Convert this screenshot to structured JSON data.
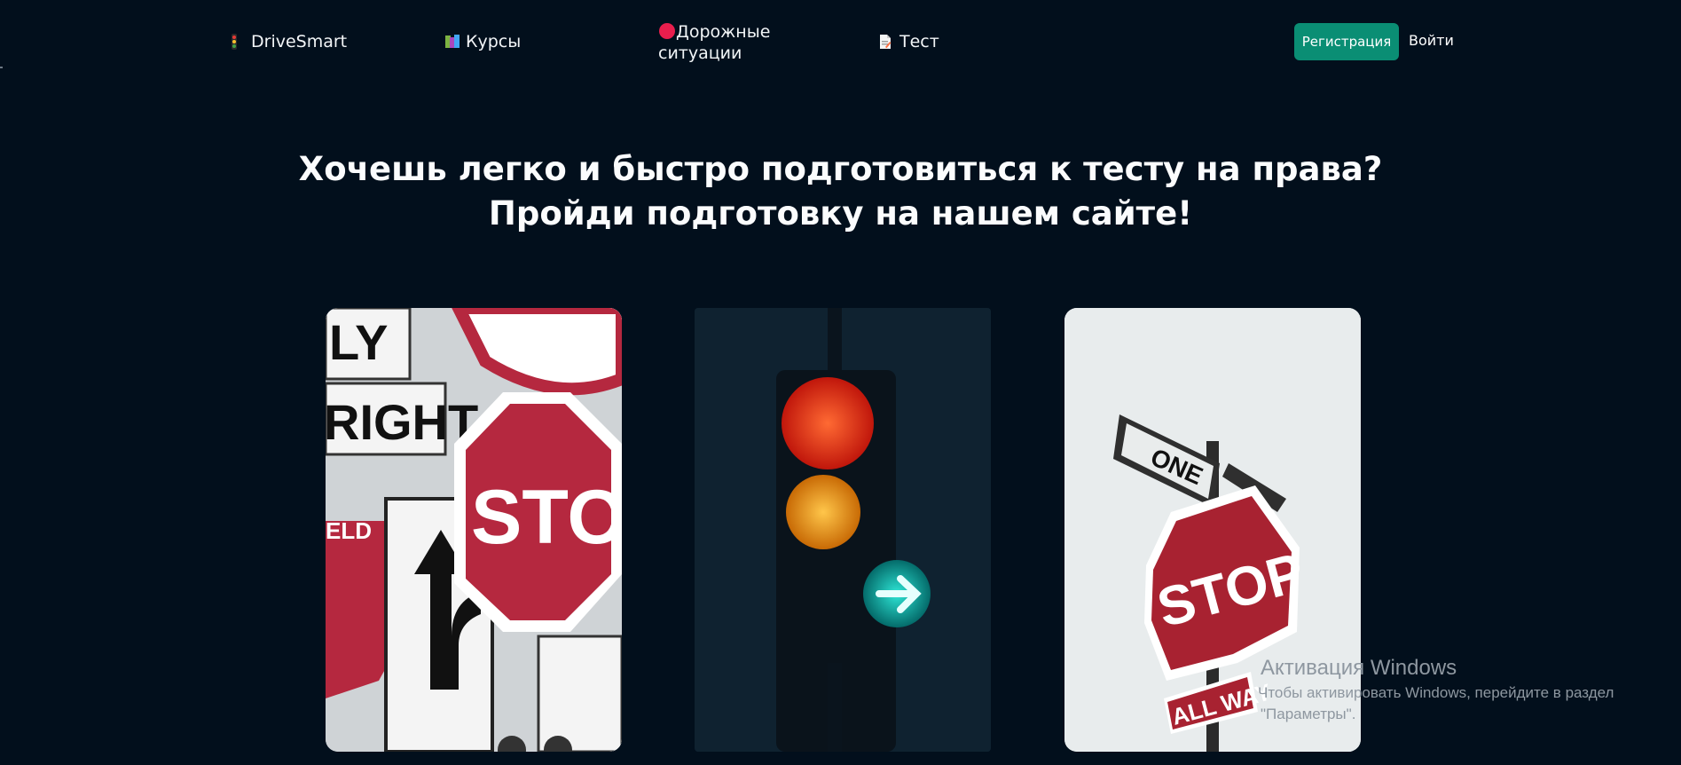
{
  "nav": {
    "brand": "DriveSmart",
    "courses": "Курсы",
    "situations": "Дорожные ситуации",
    "test": "Тест",
    "register": "Регистрация",
    "login": "Войти"
  },
  "hero": {
    "line1": "Хочешь легко и быстро подготовиться к тесту на права?",
    "line2": "Пройди подготовку на нашем сайте!"
  },
  "cards": [
    {
      "alt": "Road signs collage",
      "sign_texts": [
        "LY",
        "RIGHT",
        "STOP",
        "ELD"
      ]
    },
    {
      "alt": "Traffic light with green arrow"
    },
    {
      "alt": "Stop sign with street sign",
      "sign_texts": [
        "ONE",
        "STOP",
        "ALL WAY"
      ]
    }
  ],
  "windows_activation": {
    "title": "Активация Windows",
    "line1": "Чтобы активировать Windows, перейдите в раздел",
    "line2": "\"Параметры\"."
  },
  "icons": {
    "brand": "traffic-light-icon",
    "courses": "books-icon",
    "situations": "red-circle-icon",
    "test": "document-icon"
  },
  "colors": {
    "background": "#020f1c",
    "accent": "#0a8e74",
    "stop_red": "#b5283f"
  }
}
